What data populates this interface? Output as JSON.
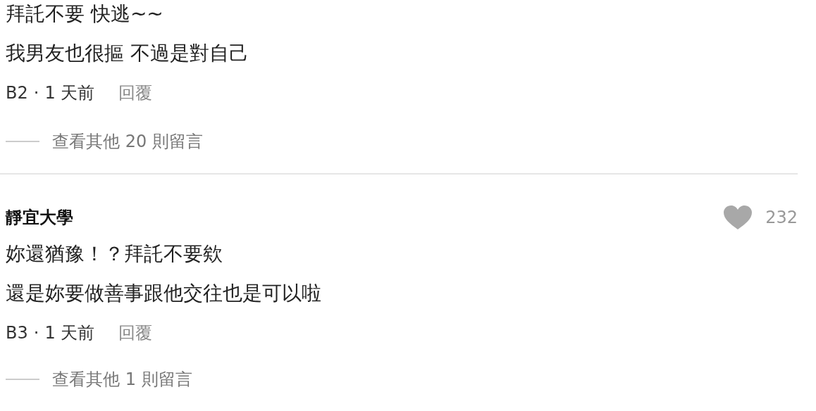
{
  "comments": [
    {
      "lines": [
        "拜託不要 快逃~~",
        "我男友也很摳 不過是對自己"
      ],
      "floor": "B2",
      "separator": "·",
      "time": "1 天前",
      "reply_label": "回覆",
      "more_replies": "查看其他 20 則留言"
    },
    {
      "author": "靜宜大學",
      "likes": "232",
      "lines": [
        "妳還猶豫！？拜託不要欸",
        "還是妳要做善事跟他交往也是可以啦"
      ],
      "floor": "B3",
      "separator": "·",
      "time": "1 天前",
      "reply_label": "回覆",
      "more_replies": "查看其他 1 則留言"
    }
  ]
}
